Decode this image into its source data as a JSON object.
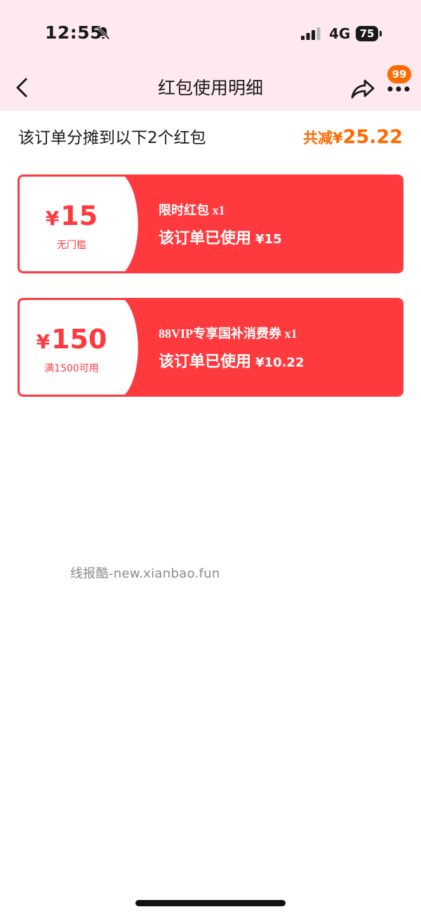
{
  "status_bar": {
    "time": "12:55",
    "network": "4G",
    "battery": "75",
    "bell_icon": "bell-muted-icon",
    "signal_icon": "cellular-signal-icon"
  },
  "nav": {
    "title": "红包使用明细",
    "back_icon": "chevron-left-icon",
    "share_icon": "share-arrow-icon",
    "more_icon": "more-dots-icon",
    "badge": "99"
  },
  "summary": {
    "text": "该订单分摊到以下2个红包",
    "total_label": "共减¥",
    "total_amount": "25.22"
  },
  "coupons": [
    {
      "value": "15",
      "currency": "¥",
      "condition": "无门槛",
      "name": "限时红包 x1",
      "used_label": "该订单已使用",
      "used_amount": "¥15"
    },
    {
      "value": "150",
      "currency": "¥",
      "condition": "满1500可用",
      "name": "88VIP专享国补消费券 x1",
      "used_label": "该订单已使用",
      "used_amount": "¥10.22"
    }
  ],
  "watermark": "线报酷-new.xianbao.fun",
  "colors": {
    "accent_red": "#ff3a3e",
    "accent_orange": "#ff6a00",
    "header_bg": "#fde9ee"
  }
}
